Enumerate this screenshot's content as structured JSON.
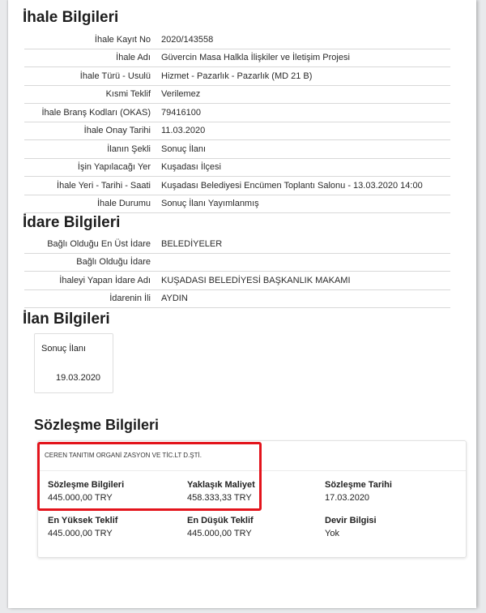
{
  "ihale": {
    "title": "İhale Bilgileri",
    "rows": [
      {
        "k": "İhale Kayıt No",
        "v": "2020/143558"
      },
      {
        "k": "İhale Adı",
        "v": "Güvercin Masa Halkla İlişkiler ve İletişim Projesi"
      },
      {
        "k": "İhale Türü - Usulü",
        "v": "Hizmet - Pazarlık - Pazarlık (MD 21 B)"
      },
      {
        "k": "Kısmi Teklif",
        "v": "Verilemez"
      },
      {
        "k": "İhale Branş Kodları (OKAS)",
        "v": "79416100"
      },
      {
        "k": "İhale Onay Tarihi",
        "v": "11.03.2020"
      },
      {
        "k": "İlanın Şekli",
        "v": "Sonuç İlanı"
      },
      {
        "k": "İşin Yapılacağı Yer",
        "v": "Kuşadası İlçesi"
      },
      {
        "k": "İhale Yeri - Tarihi - Saati",
        "v": "Kuşadası Belediyesi Encümen Toplantı Salonu - 13.03.2020 14:00"
      },
      {
        "k": "İhale Durumu",
        "v": "Sonuç İlanı Yayımlanmış"
      }
    ]
  },
  "idare": {
    "title": "İdare Bilgileri",
    "rows": [
      {
        "k": "Bağlı Olduğu En Üst İdare",
        "v": "BELEDİYELER"
      },
      {
        "k": "Bağlı Olduğu İdare",
        "v": ""
      },
      {
        "k": "İhaleyi Yapan İdare Adı",
        "v": "KUŞADASI BELEDİYESİ BAŞKANLIK MAKAMI"
      },
      {
        "k": "İdarenin İli",
        "v": "AYDIN"
      }
    ]
  },
  "ilan": {
    "title": "İlan Bilgileri",
    "type": "Sonuç İlanı",
    "date": "19.03.2020"
  },
  "sozlesme": {
    "title": "Sözleşme Bilgileri",
    "company": "CEREN TANITIM ORGANİ ZASYON VE TİC.LT D.ŞTİ.",
    "fields": [
      {
        "label": "Sözleşme Bilgileri",
        "value": "445.000,00 TRY"
      },
      {
        "label": "Yaklaşık Maliyet",
        "value": "458.333,33 TRY"
      },
      {
        "label": "Sözleşme Tarihi",
        "value": "17.03.2020"
      },
      {
        "label": "En Yüksek Teklif",
        "value": "445.000,00 TRY"
      },
      {
        "label": "En Düşük Teklif",
        "value": "445.000,00 TRY"
      },
      {
        "label": "Devir Bilgisi",
        "value": "Yok"
      }
    ]
  },
  "colors": {
    "highlight": "#e3141c",
    "divider": "#d8d8d8"
  }
}
